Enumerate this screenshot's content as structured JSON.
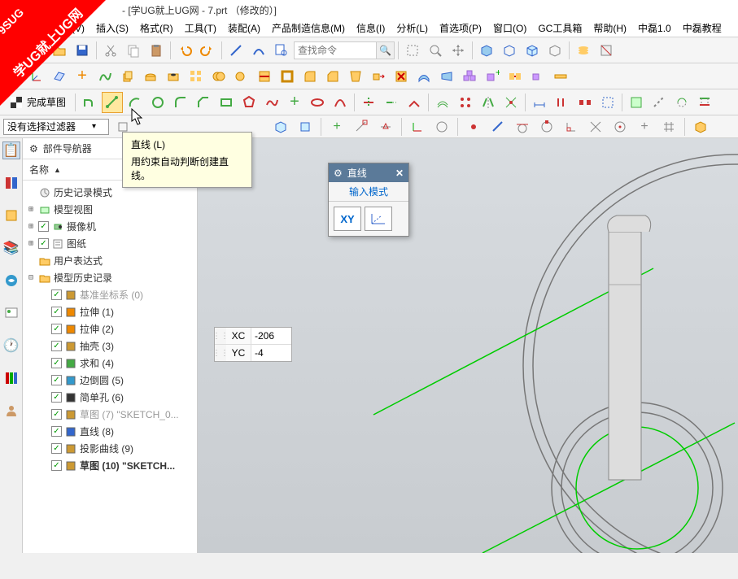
{
  "title": "- [学UG就上UG网 - 7.prt （修改的）]",
  "watermark": {
    "line1": "9SUG",
    "line2": "学UG就上UG网"
  },
  "menu": [
    "视图(V)",
    "插入(S)",
    "格式(R)",
    "工具(T)",
    "装配(A)",
    "产品制造信息(M)",
    "信息(I)",
    "分析(L)",
    "首选项(P)",
    "窗口(O)",
    "GC工具箱",
    "帮助(H)",
    "中磊1.0",
    "中磊教程"
  ],
  "search_placeholder": "查找命令",
  "finish_sketch": "完成草图",
  "filter_label": "没有选择过滤器",
  "nav_title": "部件导航器",
  "nav_col": "名称",
  "tree": {
    "history_mode": "历史记录模式",
    "model_view": "模型视图",
    "camera": "摄像机",
    "drawing": "图纸",
    "user_expr": "用户表达式",
    "history": "模型历史记录",
    "items": [
      {
        "lbl": "基准坐标系 (0)",
        "dim": true,
        "icon": "#c93"
      },
      {
        "lbl": "拉伸 (1)",
        "icon": "#e80"
      },
      {
        "lbl": "拉伸 (2)",
        "icon": "#e80"
      },
      {
        "lbl": "抽壳 (3)",
        "icon": "#c93"
      },
      {
        "lbl": "求和 (4)",
        "icon": "#4a4"
      },
      {
        "lbl": "边倒圆 (5)",
        "icon": "#39c"
      },
      {
        "lbl": "简单孔 (6)",
        "icon": "#333"
      },
      {
        "lbl": "草图 (7) \"SKETCH_0...",
        "dim": true,
        "icon": "#c93"
      },
      {
        "lbl": "直线 (8)",
        "icon": "#36c"
      },
      {
        "lbl": "投影曲线 (9)",
        "icon": "#c93"
      },
      {
        "lbl": "草图 (10) \"SKETCH...",
        "bold": true,
        "icon": "#c93"
      }
    ]
  },
  "tooltip": {
    "title": "直线 (L)",
    "desc": "用约束自动判断创建直线。"
  },
  "line_panel": {
    "title": "直线",
    "sub": "输入模式",
    "btn1": "XY"
  },
  "coords": {
    "xc_lbl": "XC",
    "yc_lbl": "YC",
    "xc": "-206",
    "yc": "-4"
  }
}
